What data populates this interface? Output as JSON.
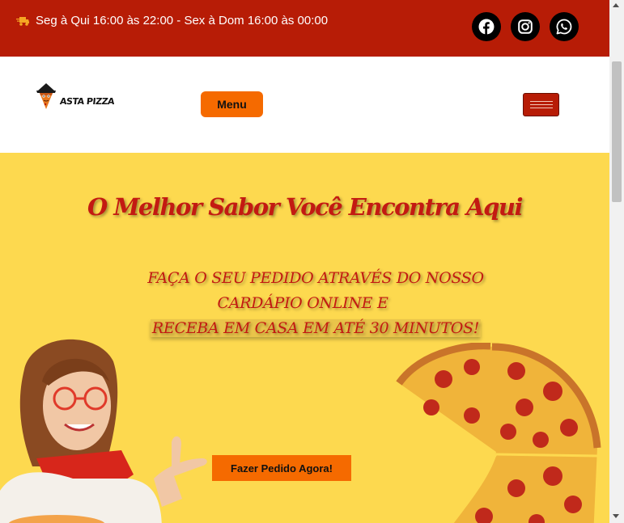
{
  "topbar": {
    "hours_text": "Seg à Qui 16:00 às 22:00 - Sex à Dom 16:00 às 00:00",
    "hours_icon": "truck-icon",
    "bg_color": "#b71c06",
    "social": [
      "facebook-icon",
      "instagram-icon",
      "whatsapp-icon"
    ]
  },
  "header": {
    "logo_text": "ASTA PIZZA",
    "menu_label": "Menu",
    "menu_toggle_icon": "hamburger-icon",
    "accent_color": "#f56a00"
  },
  "hero": {
    "headline": "O Melhor Sabor Você Encontra Aqui",
    "subline_1": "FAÇA O SEU PEDIDO ATRAVÉS DO NOSSO",
    "subline_2": "CARDÁPIO ONLINE E",
    "subline_3": "RECEBA EM CASA EM ATÉ 30 MINUTOS!",
    "cta_label": "Fazer Pedido Agora!",
    "bg_color": "#fdd94f",
    "text_color": "#c31a12"
  }
}
